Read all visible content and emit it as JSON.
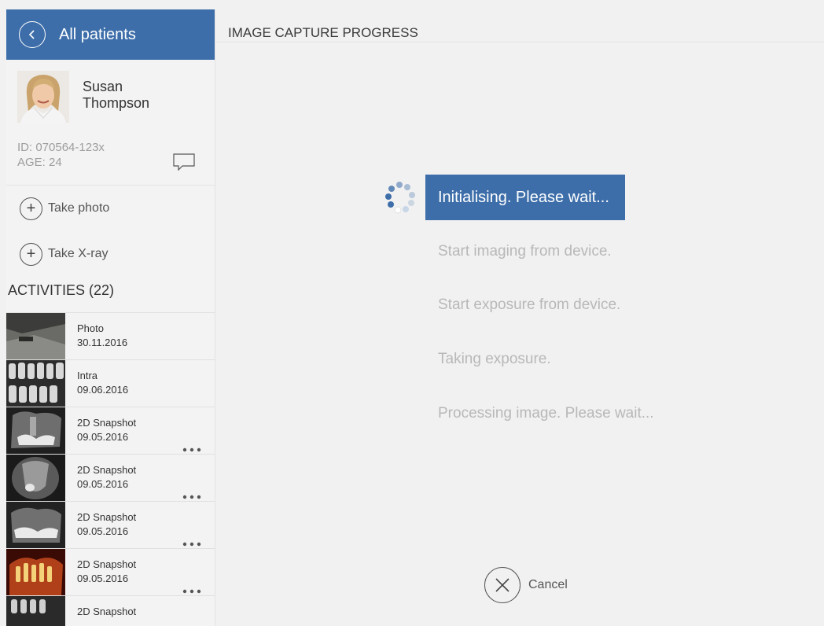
{
  "sidebar": {
    "back_label": "All patients",
    "patient": {
      "name_line1": "Susan",
      "name_line2": "Thompson",
      "id": "ID: 070564-123x",
      "age": "AGE: 24"
    },
    "actions": [
      {
        "label": "Take photo"
      },
      {
        "label": "Take X-ray"
      }
    ],
    "activities_title": "ACTIVITIES (22)",
    "activities": [
      {
        "title": "Photo",
        "date": "30.11.2016"
      },
      {
        "title": "Intra",
        "date": "09.06.2016"
      },
      {
        "title": "2D Snapshot",
        "date": "09.05.2016"
      },
      {
        "title": "2D Snapshot",
        "date": "09.05.2016"
      },
      {
        "title": "2D Snapshot",
        "date": "09.05.2016"
      },
      {
        "title": "2D Snapshot",
        "date": "09.05.2016"
      },
      {
        "title": "2D Snapshot",
        "date": ""
      }
    ]
  },
  "main": {
    "header": "IMAGE CAPTURE PROGRESS",
    "current_status": "Initialising. Please wait...",
    "steps": [
      "Start imaging from device.",
      "Start exposure from device.",
      "Taking exposure.",
      "Processing image. Please wait..."
    ],
    "cancel_label": "Cancel"
  },
  "colors": {
    "accent": "#3d6ea9",
    "background": "#f1f1f1",
    "inactive_text": "#b8b8b8"
  }
}
